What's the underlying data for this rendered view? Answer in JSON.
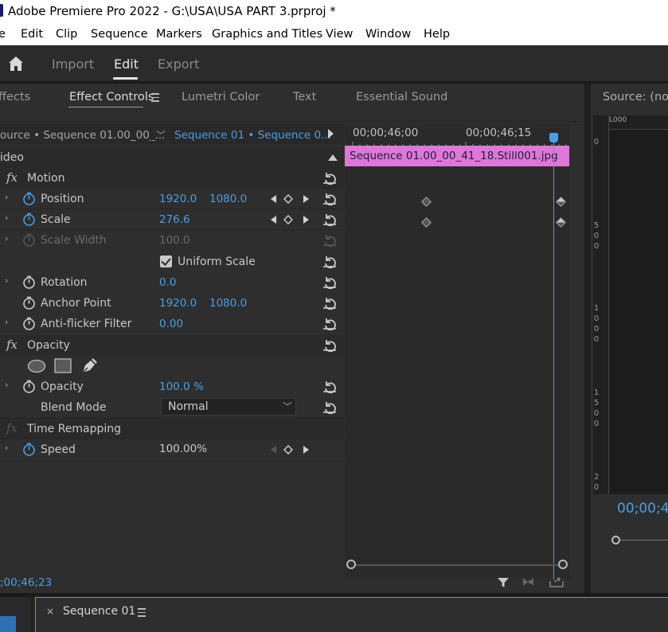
{
  "titlebar": {
    "title": "Adobe Premiere Pro 2022 - G:\\USA\\USA PART 3.prproj *"
  },
  "menubar": {
    "items": [
      "e",
      "Edit",
      "Clip",
      "Sequence",
      "Markers",
      "Graphics and Titles",
      "View",
      "Window",
      "Help"
    ]
  },
  "workspace": {
    "tabs": [
      "Import",
      "Edit",
      "Export"
    ],
    "active": "Edit"
  },
  "panel_tabs": [
    "ffects",
    "Effect Controls",
    "Lumetri Color",
    "Text",
    "Essential Sound"
  ],
  "source_row": {
    "master": "ource • Sequence 01.00_00_...",
    "sequence": "Sequence 01 • Sequence 0..."
  },
  "video_section": "ideo",
  "effects": {
    "motion": {
      "label": "Motion",
      "position": {
        "label": "Position",
        "x": "1920.0",
        "y": "1080.0"
      },
      "scale": {
        "label": "Scale",
        "value": "276.6"
      },
      "scale_width": {
        "label": "Scale Width",
        "value": "100.0"
      },
      "uniform_scale": {
        "label": "Uniform Scale",
        "checked": true
      },
      "rotation": {
        "label": "Rotation",
        "value": "0.0"
      },
      "anchor_point": {
        "label": "Anchor Point",
        "x": "1920.0",
        "y": "1080.0"
      },
      "anti_flicker": {
        "label": "Anti-flicker Filter",
        "value": "0.00"
      }
    },
    "opacity": {
      "label": "Opacity",
      "opacity": {
        "label": "Opacity",
        "value": "100.0 %"
      },
      "blend_mode": {
        "label": "Blend Mode",
        "value": "Normal"
      }
    },
    "time_remapping": {
      "label": "Time Remapping",
      "speed": {
        "label": "Speed",
        "value": "100.00%"
      }
    }
  },
  "timeline": {
    "tc_start": "00;00;46;00",
    "tc_mid": "00;00;46;15",
    "clip_name": "Sequence 01.00_00_41_18.Still001.jpg"
  },
  "current_timecode": ";00;46;23",
  "source_monitor": {
    "title": "Source: (no cl",
    "ruler_label": "L000",
    "timecode": "00;00;4",
    "ruler_numbers": [
      [
        "0"
      ],
      [
        "5",
        "0",
        "0"
      ],
      [
        "1",
        "0",
        "0",
        "0"
      ],
      [
        "1",
        "5",
        "0",
        "0"
      ],
      [
        "2",
        "0"
      ]
    ]
  },
  "timeline_panel": {
    "tab": "Sequence 01",
    "close": "×"
  },
  "colors": {
    "accent": "#4a9fe6",
    "clip": "#de78d8",
    "panel_bg": "#2e2e2e"
  }
}
